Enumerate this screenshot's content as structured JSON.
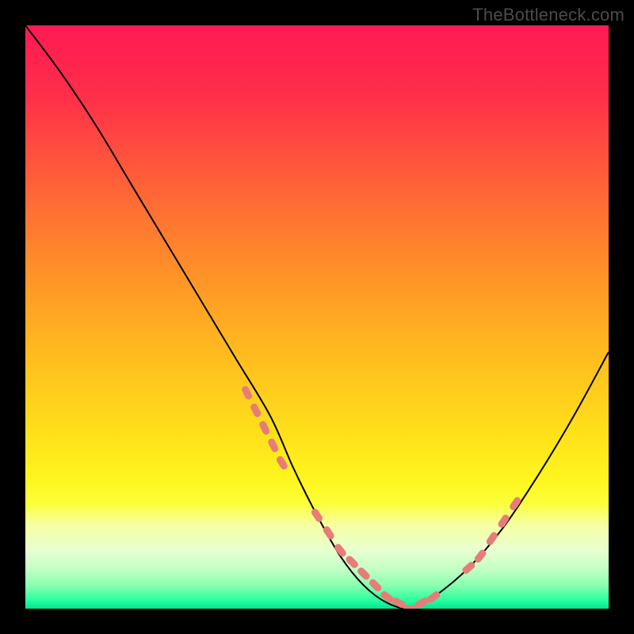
{
  "watermark": "TheBottleneck.com",
  "gradient_stops": [
    {
      "offset": 0.0,
      "color": "#ff1a52"
    },
    {
      "offset": 0.12,
      "color": "#ff2e4a"
    },
    {
      "offset": 0.25,
      "color": "#ff5a3a"
    },
    {
      "offset": 0.4,
      "color": "#ff8a2a"
    },
    {
      "offset": 0.55,
      "color": "#ffb81f"
    },
    {
      "offset": 0.7,
      "color": "#ffe01a"
    },
    {
      "offset": 0.78,
      "color": "#fff61f"
    },
    {
      "offset": 0.82,
      "color": "#fbff3a"
    },
    {
      "offset": 0.855,
      "color": "#f6ffa0"
    },
    {
      "offset": 0.9,
      "color": "#e8ffd0"
    },
    {
      "offset": 0.93,
      "color": "#c6ffc6"
    },
    {
      "offset": 0.96,
      "color": "#8affb0"
    },
    {
      "offset": 0.985,
      "color": "#2bffa0"
    },
    {
      "offset": 1.0,
      "color": "#00e68e"
    }
  ],
  "chart_data": {
    "type": "line",
    "title": "",
    "xlabel": "",
    "ylabel": "",
    "xlim": [
      0,
      100
    ],
    "ylim": [
      0,
      100
    ],
    "series": [
      {
        "name": "bottleneck-curve",
        "x": [
          0,
          6,
          12,
          18,
          24,
          30,
          36,
          42,
          46,
          50,
          54,
          58,
          62,
          66,
          70,
          76,
          82,
          88,
          94,
          100
        ],
        "y": [
          100,
          92,
          83,
          73,
          63,
          53,
          43,
          33,
          24,
          16,
          9,
          4,
          1,
          0,
          2,
          7,
          14,
          23,
          33,
          44
        ]
      }
    ],
    "markers": {
      "name": "highlight-dots",
      "x": [
        38,
        39.5,
        41,
        42.5,
        44,
        50,
        52,
        54,
        56,
        58,
        60,
        62,
        64,
        66,
        68,
        70,
        76,
        78,
        80,
        82,
        84
      ],
      "y": [
        37,
        34,
        31,
        28,
        25,
        16,
        13,
        10,
        8,
        6,
        4,
        2,
        1,
        0,
        1,
        2,
        7,
        9,
        12,
        15,
        18
      ]
    }
  }
}
